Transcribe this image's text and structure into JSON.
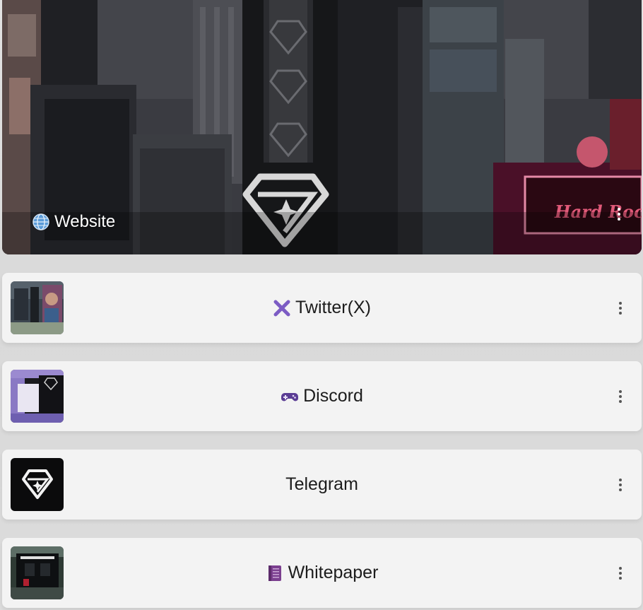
{
  "hero": {
    "label": "Website",
    "icon": "globe-icon",
    "billboard_text": "Hard Rock"
  },
  "links": [
    {
      "label": "Twitter(X)",
      "icon": "x-cross-icon"
    },
    {
      "label": "Discord",
      "icon": "game-controller-icon"
    },
    {
      "label": "Telegram",
      "icon": ""
    },
    {
      "label": "Whitepaper",
      "icon": "purple-book-icon"
    }
  ],
  "colors": {
    "card_bg": "#f3f3f3",
    "page_bg": "#dcdcdc",
    "accent_purple": "#7c5cc4",
    "text": "#1c1c1c"
  }
}
